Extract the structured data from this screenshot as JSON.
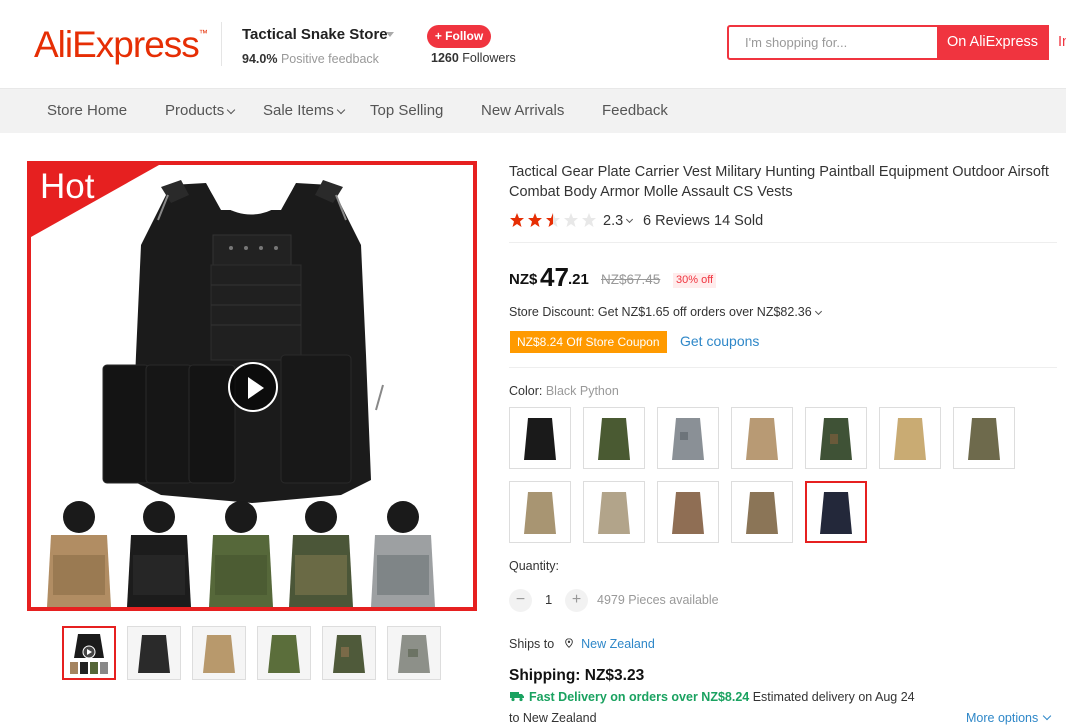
{
  "header": {
    "logo": "AliExpress",
    "store_name": "Tactical Snake Store",
    "feedback_pct": "94.0%",
    "feedback_label": "Positive feedback",
    "follow_label": "+ Follow",
    "followers_count": "1260",
    "followers_label": "Followers",
    "search_placeholder": "I'm shopping for...",
    "search_button": "On AliExpress",
    "search_button2": "In"
  },
  "nav": {
    "items": [
      "Store Home",
      "Products",
      "Sale Items",
      "Top Selling",
      "New Arrivals",
      "Feedback"
    ]
  },
  "gallery": {
    "badge": "Hot"
  },
  "product": {
    "title": "Tactical Gear Plate Carrier Vest Military Hunting Paintball Equipment Outdoor Airsoft Combat Body Armor Molle Assault CS Vests",
    "rating": "2.3",
    "rating_value": 2.3,
    "reviews": "6 Reviews",
    "sold": "14 Sold",
    "price_currency": "NZ$",
    "price_int": "47",
    "price_dec": ".21",
    "price_original": "NZ$67.45",
    "discount": "30% off",
    "store_discount": "Store Discount: Get NZ$1.65 off orders over NZ$82.36",
    "coupon": "NZ$8.24 Off Store Coupon",
    "get_coupons": "Get coupons",
    "color_label": "Color:",
    "color_value": "Black Python",
    "quantity_label": "Quantity:",
    "quantity": "1",
    "minus": "−",
    "plus": "+",
    "available": "4979 Pieces available",
    "ships_to_label": "Ships to",
    "ships_to_country": "New Zealand",
    "shipping": "Shipping: NZ$3.23",
    "fast_delivery": "Fast Delivery on orders over NZ$8.24",
    "estimated": "Estimated delivery on Aug 24",
    "to_country": "to New Zealand",
    "more_options": "More options"
  },
  "colors": {
    "black": "#1a1a1a",
    "green": "#4a5a32",
    "acu": "#8a9096",
    "tan": "#b89a74",
    "woodland": "#3f5236",
    "khaki": "#c9ab73",
    "olive_camo": "#6e6a4c",
    "desert_camo": "#a89572",
    "light_camo": "#b2a48a",
    "brown_camo": "#8f6e54",
    "mud": "#8b7557",
    "navy": "#23283a"
  }
}
